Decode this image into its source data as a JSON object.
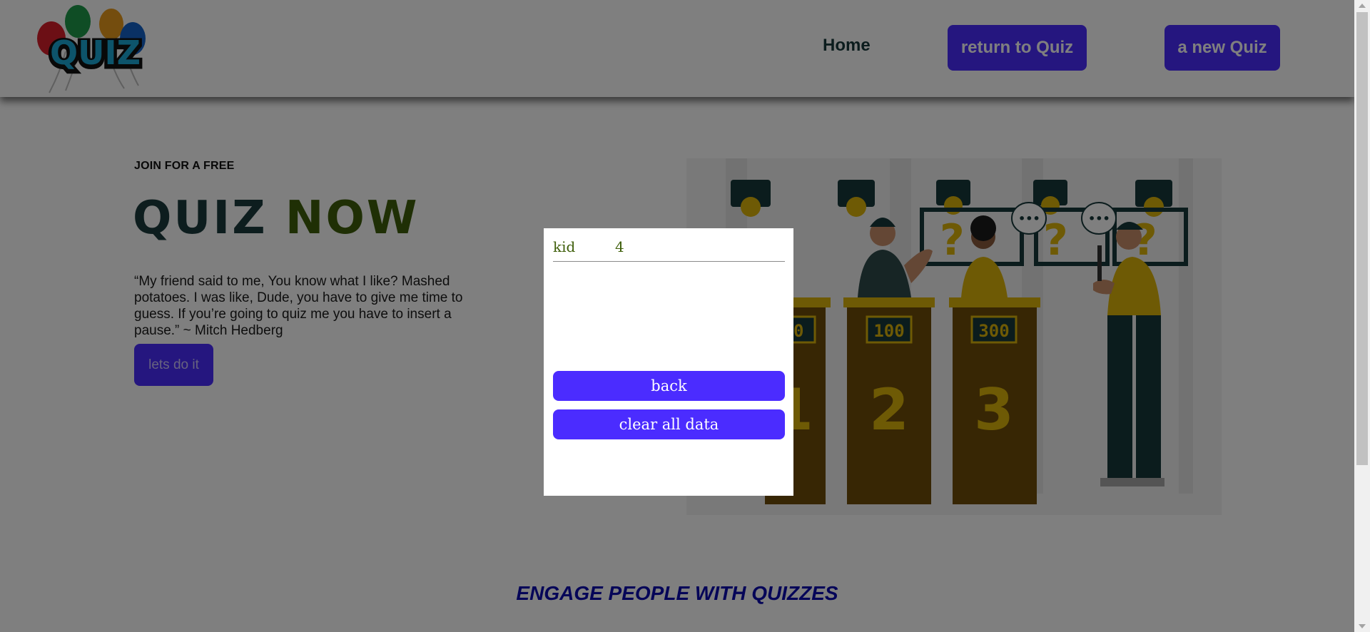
{
  "header": {
    "logo_text": "QUIZ",
    "nav": {
      "home": "Home",
      "return_to_quiz": "return to Quiz",
      "new_quiz": "a new Quiz"
    }
  },
  "hero": {
    "eyebrow": "JOIN FOR A FREE",
    "title_part1": "QUIZ",
    "title_part2": "NOW",
    "quote": "“My friend said to me, You know what I like? Mashed potatoes. I was like, Dude, you have to give me time to guess. If you’re going to quiz me you have to insert a pause.” ~ Mitch Hedberg",
    "cta": "lets do it",
    "illustration": {
      "podium_scores": [
        "50",
        "100",
        "300"
      ],
      "podium_numbers": [
        "1",
        "2",
        "3"
      ]
    }
  },
  "section": {
    "title": "ENGAGE PEOPLE WITH QUIZZES"
  },
  "modal": {
    "rows": [
      {
        "name": "kid",
        "score": "4"
      }
    ],
    "back": "back",
    "clear": "clear all data"
  },
  "colors": {
    "accent": "#4b2cff",
    "title_dark": "#1b3a3c",
    "title_green": "#3f5f0b",
    "section_blue": "#0b0bb0",
    "podium_brown": "#6e4c08",
    "mustard": "#dcb40a"
  }
}
